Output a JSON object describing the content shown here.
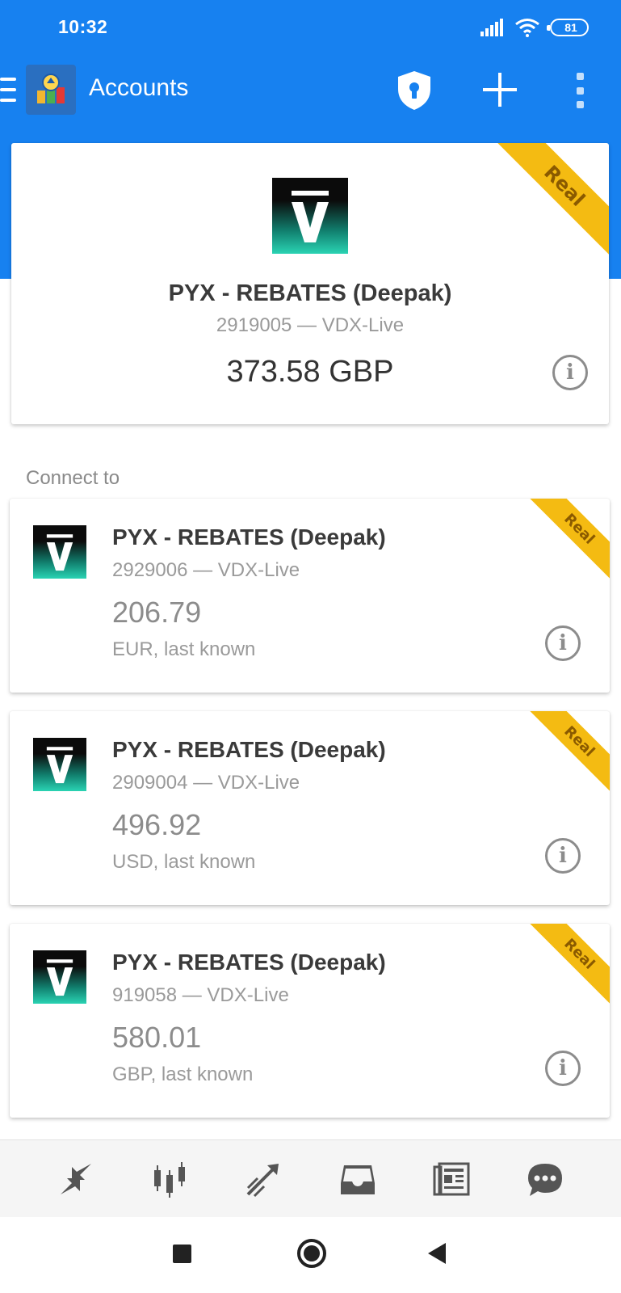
{
  "status_bar": {
    "time": "10:32",
    "battery": "81"
  },
  "toolbar": {
    "title": "Accounts",
    "icons": [
      "menu-icon",
      "app-logo",
      "shield-lock-icon",
      "plus-icon",
      "more-vertical-icon"
    ]
  },
  "current_account": {
    "badge": "Real",
    "name": "PYX - REBATES (Deepak)",
    "details": "2919005 — VDX-Live",
    "balance": "373.58 GBP"
  },
  "connect_label": "Connect to",
  "accounts": [
    {
      "badge": "Real",
      "name": "PYX - REBATES (Deepak)",
      "details": "2929006 — VDX-Live",
      "balance": "206.79",
      "currency_note": "EUR, last known"
    },
    {
      "badge": "Real",
      "name": "PYX - REBATES (Deepak)",
      "details": "2909004 — VDX-Live",
      "balance": "496.92",
      "currency_note": "USD, last known"
    },
    {
      "badge": "Real",
      "name": "PYX - REBATES (Deepak)",
      "details": "919058 — VDX-Live",
      "balance": "580.01",
      "currency_note": "GBP, last known"
    }
  ],
  "tab_bar": {
    "icons": [
      "quotes-icon",
      "chart-candles-icon",
      "trade-icon",
      "inbox-icon",
      "news-icon",
      "chat-icon"
    ]
  },
  "colors": {
    "header_blue": "#1781f0",
    "ribbon_yellow": "#f4bb12",
    "logo_teal": "#2ad3b3"
  }
}
